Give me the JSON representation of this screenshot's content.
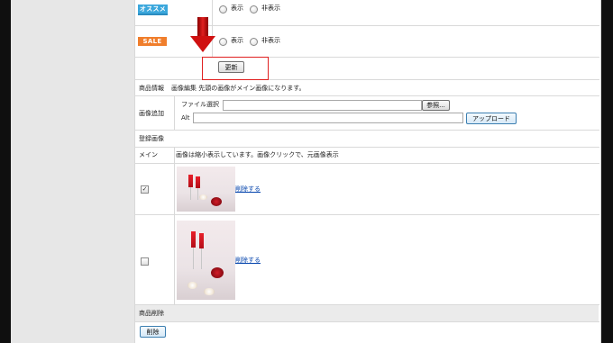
{
  "badges": {
    "osusume": "オススメ",
    "sale": "SALE"
  },
  "visibility": {
    "show": "表示",
    "hide": "非表示"
  },
  "update_button": "更新",
  "product_info_label": "商品情報",
  "image_edit_text": "画像編集 先頭の画像がメイン画像になります。",
  "image_add_label": "画像追加",
  "file_select_label": "ファイル選択",
  "browse_button": "参照...",
  "alt_label": "Alt",
  "upload_button": "アップロード",
  "registered_images_label": "登録画像",
  "main_label": "メイン",
  "main_note": "画像は縮小表示しています。画像クリックで、元画像表示",
  "images": [
    {
      "delete_link": "削除する",
      "checked": true,
      "check_mark": "✓"
    },
    {
      "delete_link": "削除する",
      "checked": false,
      "check_mark": ""
    }
  ],
  "product_delete_label": "商品削除",
  "delete_button": "削除"
}
